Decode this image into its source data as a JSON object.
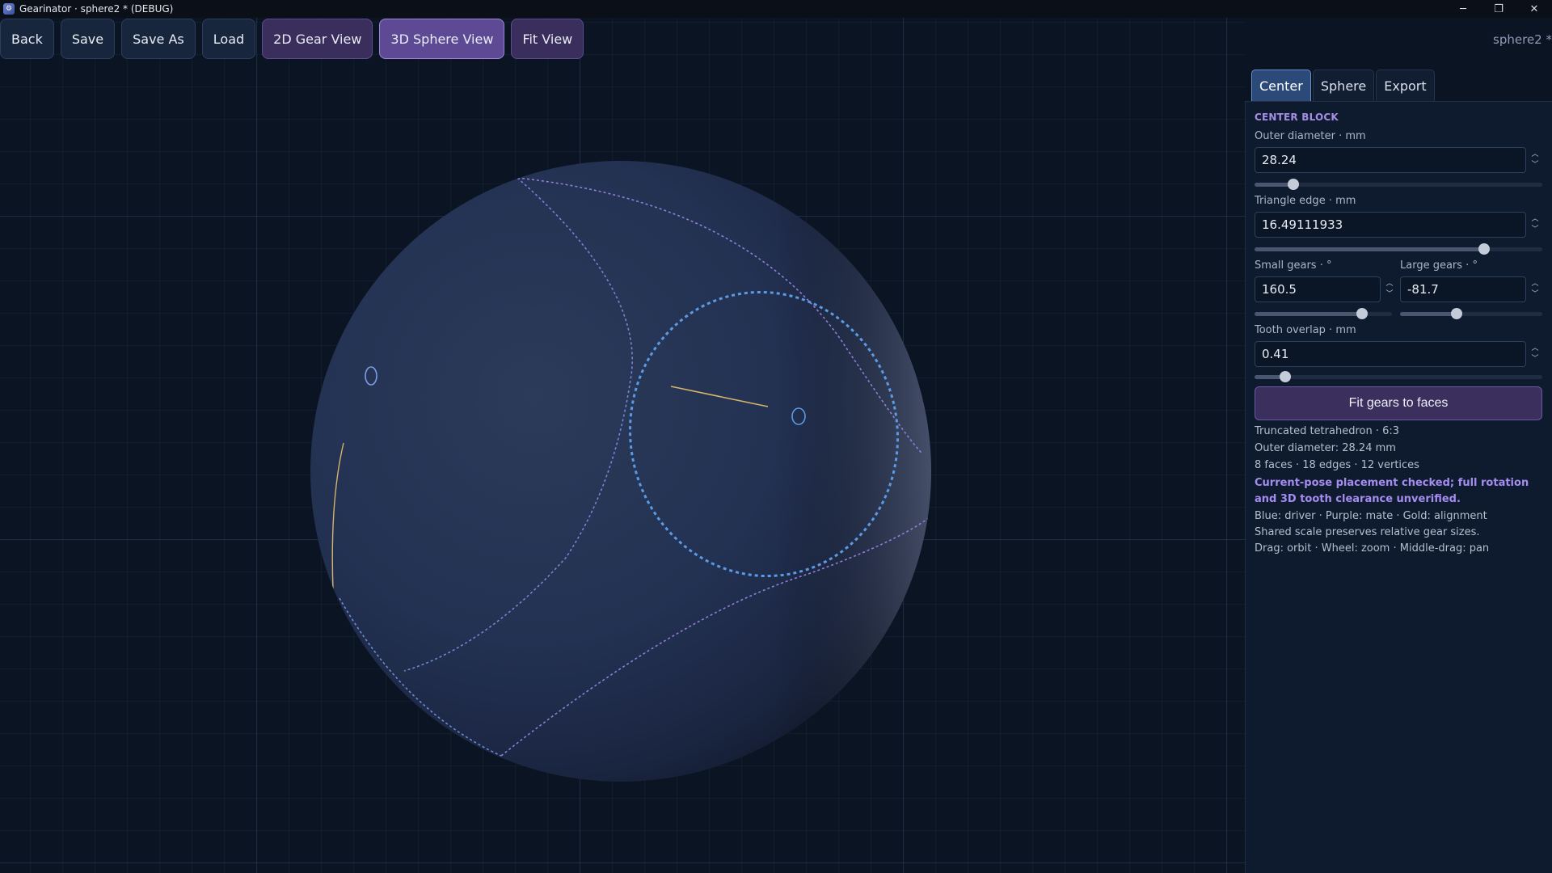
{
  "window": {
    "title": "Gearinator · sphere2 * (DEBUG)",
    "icon": "app-icon",
    "controls": {
      "minimize": "─",
      "restore": "❐",
      "close": "✕"
    }
  },
  "toolbar": {
    "back": "Back",
    "save": "Save",
    "save_as": "Save As",
    "load": "Load",
    "gear_view": "2D Gear View",
    "sphere_view": "3D Sphere View",
    "fit_view": "Fit View",
    "active_view": "3D Sphere View"
  },
  "document": {
    "name": "sphere2 *"
  },
  "tabs": {
    "center": "Center",
    "sphere": "Sphere",
    "export": "Export",
    "active": "Center"
  },
  "panel": {
    "section": "CENTER BLOCK",
    "outer_diameter": {
      "label": "Outer diameter · mm",
      "value": "28.24",
      "slider": 0.12
    },
    "triangle_edge": {
      "label": "Triangle edge · mm",
      "value": "16.49111933",
      "slider": 0.81
    },
    "small_gears": {
      "label": "Small gears · °",
      "value": "160.5",
      "slider": 0.81
    },
    "large_gears": {
      "label": "Large gears · °",
      "value": "-81.7",
      "slider": 0.39
    },
    "tooth_overlap": {
      "label": "Tooth overlap · mm",
      "value": "0.41",
      "slider": 0.09
    },
    "fit_button": "Fit gears to faces",
    "info": {
      "shape": "Truncated tetrahedron · 6:3",
      "diameter": "Outer diameter: 28.24 mm",
      "counts": "8 faces · 18 edges · 12 vertices",
      "warning": "Current-pose placement checked; full rotation and 3D tooth clearance unverified.",
      "legend": "Blue: driver · Purple: mate · Gold: alignment",
      "scale_note": "Shared scale preserves relative gear sizes.",
      "controls_hint": "Drag: orbit · Wheel: zoom · Middle-drag: pan"
    }
  },
  "colors": {
    "background": "#0b1422",
    "driver": "#5b9be6",
    "mate": "#9b86e0",
    "alignment": "#d4b46a",
    "accent": "#5e4a94"
  }
}
